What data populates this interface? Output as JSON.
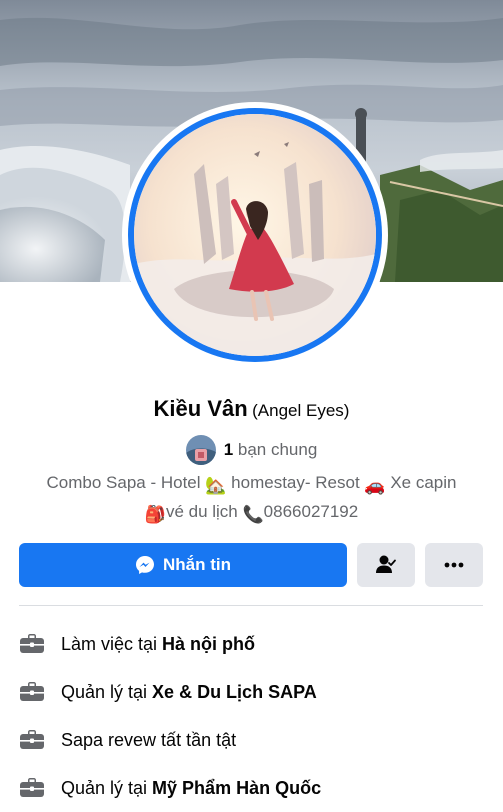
{
  "profile": {
    "name": "Kiều Vân",
    "alternate_name": "(Angel Eyes)",
    "mutual_count": "1",
    "mutual_label": "bạn chung",
    "bio": {
      "part1": "Combo Sapa - Hotel",
      "emoji1": "🏡",
      "part2": "homestay- Resot",
      "emoji2": "🚗",
      "part3": "Xe capin",
      "emoji3": "🎒",
      "part4": "vé du lịch",
      "emoji4": "📞",
      "part5": "0866027192"
    }
  },
  "actions": {
    "message_label": "Nhắn tin",
    "message_icon": "messenger-icon",
    "friend_icon": "friend-check-icon",
    "more_icon": "more-dots-icon"
  },
  "details": [
    {
      "prefix": "Làm việc tại ",
      "bold": "Hà nội phố",
      "icon": "briefcase-icon"
    },
    {
      "prefix": "Quản lý tại ",
      "bold": "Xe & Du Lịch SAPA",
      "icon": "briefcase-icon"
    },
    {
      "prefix": "Sapa revew tất tần tật",
      "bold": "",
      "icon": "briefcase-icon"
    },
    {
      "prefix": "Quản lý tại ",
      "bold": "Mỹ Phẩm Hàn Quốc",
      "icon": "briefcase-icon"
    }
  ],
  "colors": {
    "accent": "#1877f2",
    "secondary_button": "#e4e6eb",
    "muted_text": "#65676b"
  }
}
